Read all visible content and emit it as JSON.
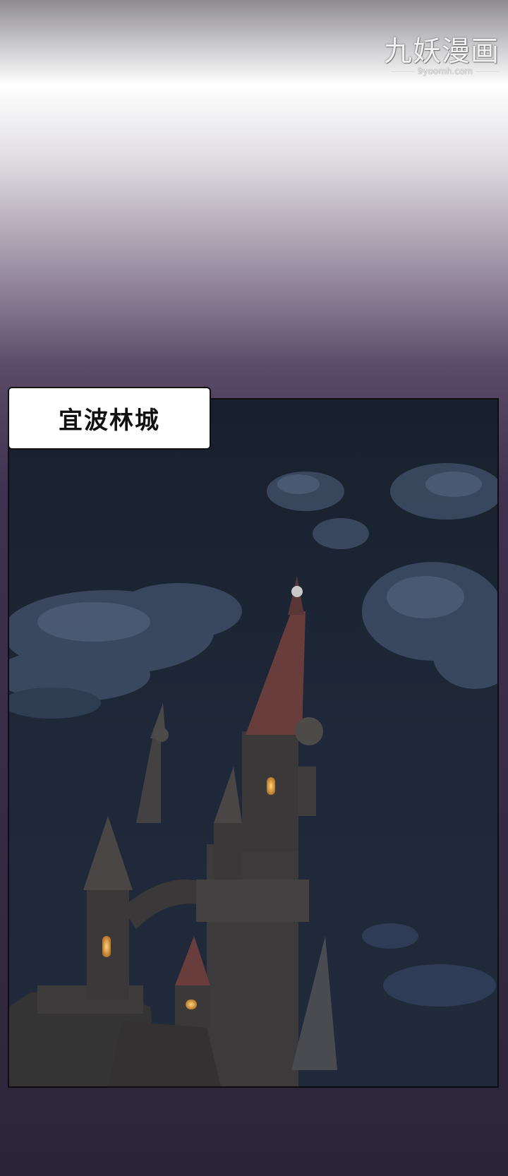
{
  "watermark": {
    "title": "九妖漫画",
    "url": "9yoomh.com"
  },
  "caption": {
    "location": "宜波林城"
  },
  "colors": {
    "sky": "#1b2331",
    "cloud": "#3f4e66",
    "castle": "#3a3838",
    "spire_roof": "#6a3d3d",
    "window_light": "#e0a84a",
    "caption_bg": "#ffffff",
    "caption_text": "#111111"
  }
}
